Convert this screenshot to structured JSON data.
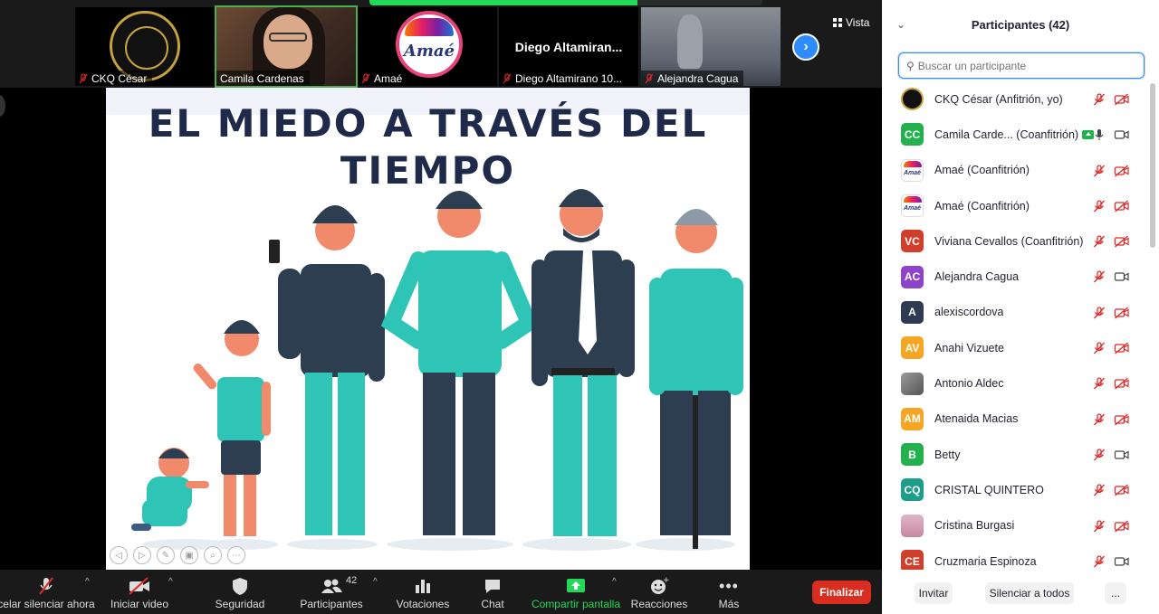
{
  "gallery": {
    "tiles": [
      {
        "name": "CKQ César",
        "muted": true
      },
      {
        "name": "Camila Cardenas",
        "muted": false
      },
      {
        "name": "Amaé",
        "muted": true
      },
      {
        "name": "Diego Altamirano 10...",
        "display_text": "Diego  Altamiran...",
        "muted": true
      },
      {
        "name": "Alejandra Cagua",
        "muted": true
      }
    ],
    "amae_logo_text": "Amaé",
    "next_icon": "chevron-right-icon",
    "view_label": "Vista"
  },
  "slide": {
    "title_line1": "EL MIEDO A TRAVÉS DEL",
    "title_line2": "TIEMPO"
  },
  "toolbar": {
    "unmute_label": "celar silenciar ahora",
    "video_label": "Iniciar video",
    "security_label": "Seguridad",
    "participants_label": "Participantes",
    "participants_count": "42",
    "polls_label": "Votaciones",
    "chat_label": "Chat",
    "share_label": "Compartir pantalla",
    "reactions_label": "Reacciones",
    "more_label": "Más",
    "end_label": "Finalizar"
  },
  "panel": {
    "title": "Participantes (42)",
    "search_placeholder": "Buscar un participante",
    "participants": [
      {
        "initials": "",
        "avatar_type": "img-ckq",
        "name": "CKQ César (Anfitrión, yo)",
        "mic": "muted",
        "video": "off"
      },
      {
        "initials": "CC",
        "avatar_color": "#23b14d",
        "name": "Camila Carde...  (Coanfitrión)",
        "sharing": true,
        "mic": "on",
        "video": "on"
      },
      {
        "initials": "",
        "avatar_type": "img-amae",
        "name": "Amaé (Coanfitrión)",
        "mic": "muted",
        "video": "off"
      },
      {
        "initials": "",
        "avatar_type": "img-amae",
        "name": "Amaé (Coanfitrión)",
        "mic": "muted",
        "video": "off"
      },
      {
        "initials": "VC",
        "avatar_color": "#d13e2c",
        "name": "Viviana Cevallos (Coanfitrión)",
        "mic": "muted",
        "video": "off"
      },
      {
        "initials": "AC",
        "avatar_color": "#8e44c8",
        "name": "Alejandra Cagua",
        "mic": "muted",
        "video": "on"
      },
      {
        "initials": "A",
        "avatar_color": "#2f3b52",
        "name": "alexiscordova",
        "mic": "muted",
        "video": "off"
      },
      {
        "initials": "AV",
        "avatar_color": "#f5a623",
        "name": "Anahi Vizuete",
        "mic": "muted",
        "video": "off"
      },
      {
        "initials": "",
        "avatar_type": "img-photo",
        "name": "Antonio Aldec",
        "mic": "muted",
        "video": "off"
      },
      {
        "initials": "AM",
        "avatar_color": "#f5a623",
        "name": "Atenaida Macias",
        "mic": "muted",
        "video": "off"
      },
      {
        "initials": "B",
        "avatar_color": "#23b14d",
        "name": "Betty",
        "mic": "muted",
        "video": "on"
      },
      {
        "initials": "CQ",
        "avatar_color": "#1e9e8a",
        "name": "CRISTAL QUINTERO",
        "mic": "muted",
        "video": "off"
      },
      {
        "initials": "",
        "avatar_type": "img-pink",
        "name": "Cristina Burgasi",
        "mic": "muted",
        "video": "off"
      },
      {
        "initials": "CE",
        "avatar_color": "#d13e2c",
        "name": "Cruzmaria Espinoza",
        "mic": "muted",
        "video": "on"
      }
    ],
    "invite_label": "Invitar",
    "mute_all_label": "Silenciar a todos",
    "more_label": "..."
  },
  "colors": {
    "accent": "#2d8cff",
    "share_green": "#23d959",
    "end_red": "#d92d20",
    "muted_red": "#e02828"
  }
}
